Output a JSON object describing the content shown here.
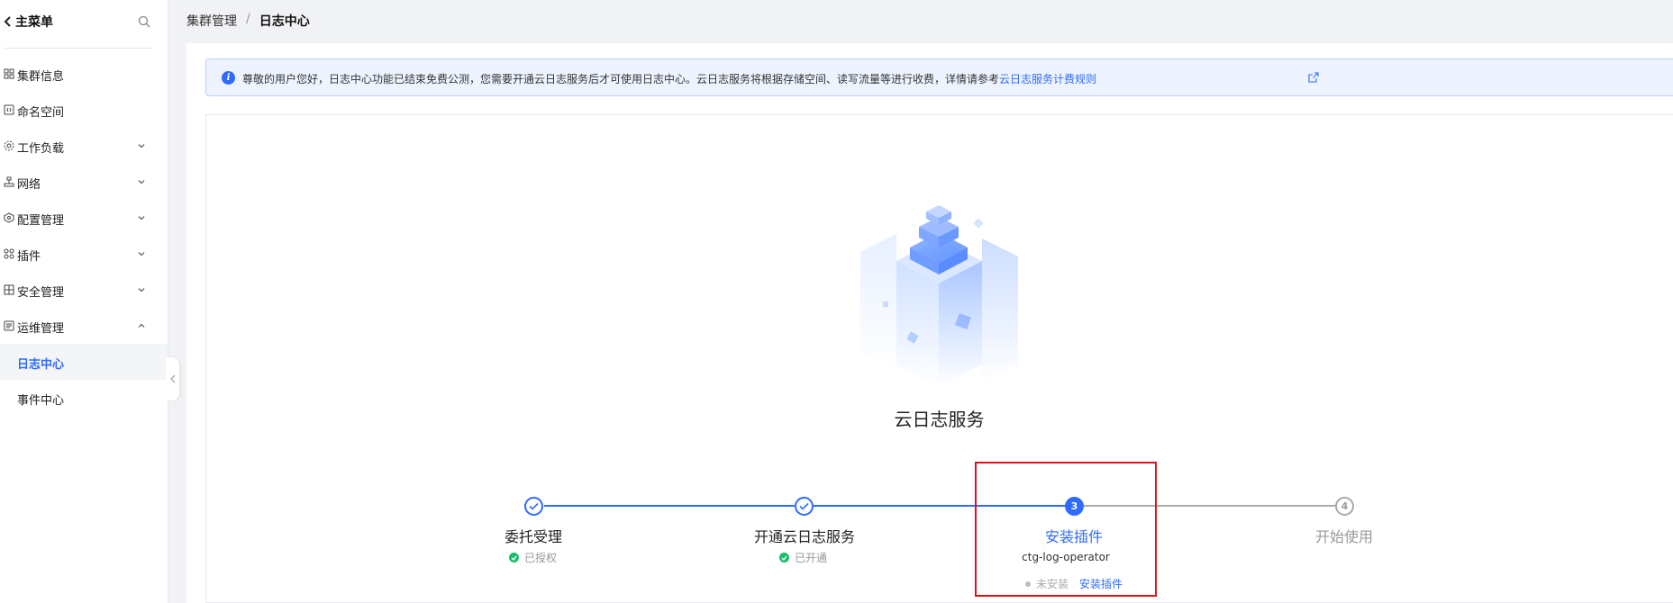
{
  "sidebar": {
    "back_label": "主菜单",
    "items": [
      {
        "label": "集群信息",
        "icon": "cluster-icon",
        "expandable": false
      },
      {
        "label": "命名空间",
        "icon": "namespace-icon",
        "expandable": false
      },
      {
        "label": "工作负载",
        "icon": "workload-icon",
        "expandable": true
      },
      {
        "label": "网络",
        "icon": "network-icon",
        "expandable": true
      },
      {
        "label": "配置管理",
        "icon": "config-icon",
        "expandable": true
      },
      {
        "label": "插件",
        "icon": "plugin-icon",
        "expandable": true
      },
      {
        "label": "安全管理",
        "icon": "security-icon",
        "expandable": true
      },
      {
        "label": "运维管理",
        "icon": "ops-icon",
        "expandable": true,
        "expanded": true
      }
    ],
    "sub_items": [
      {
        "label": "日志中心",
        "active": true
      },
      {
        "label": "事件中心",
        "active": false
      }
    ]
  },
  "breadcrumb": {
    "parent": "集群管理",
    "separator": "/",
    "current": "日志中心"
  },
  "notice": {
    "text": "尊敬的用户您好，日志中心功能已结束免费公测，您需要开通云日志服务后才可使用日志中心。云日志服务将根据存储空间、读写流量等进行收费，详情请参考",
    "link": "云日志服务计费规则"
  },
  "service": {
    "title": "云日志服务"
  },
  "steps": [
    {
      "number": "1",
      "title": "委托受理",
      "status": "已授权",
      "state": "done"
    },
    {
      "number": "2",
      "title": "开通云日志服务",
      "status": "已开通",
      "state": "done"
    },
    {
      "number": "3",
      "title": "安装插件",
      "plugin": "ctg-log-operator",
      "status": "未安装",
      "action": "安装插件",
      "state": "current"
    },
    {
      "number": "4",
      "title": "开始使用",
      "state": "todo"
    }
  ],
  "colors": {
    "accent": "#2f6bff",
    "success": "#19be6b",
    "highlight": "#e0101a"
  }
}
